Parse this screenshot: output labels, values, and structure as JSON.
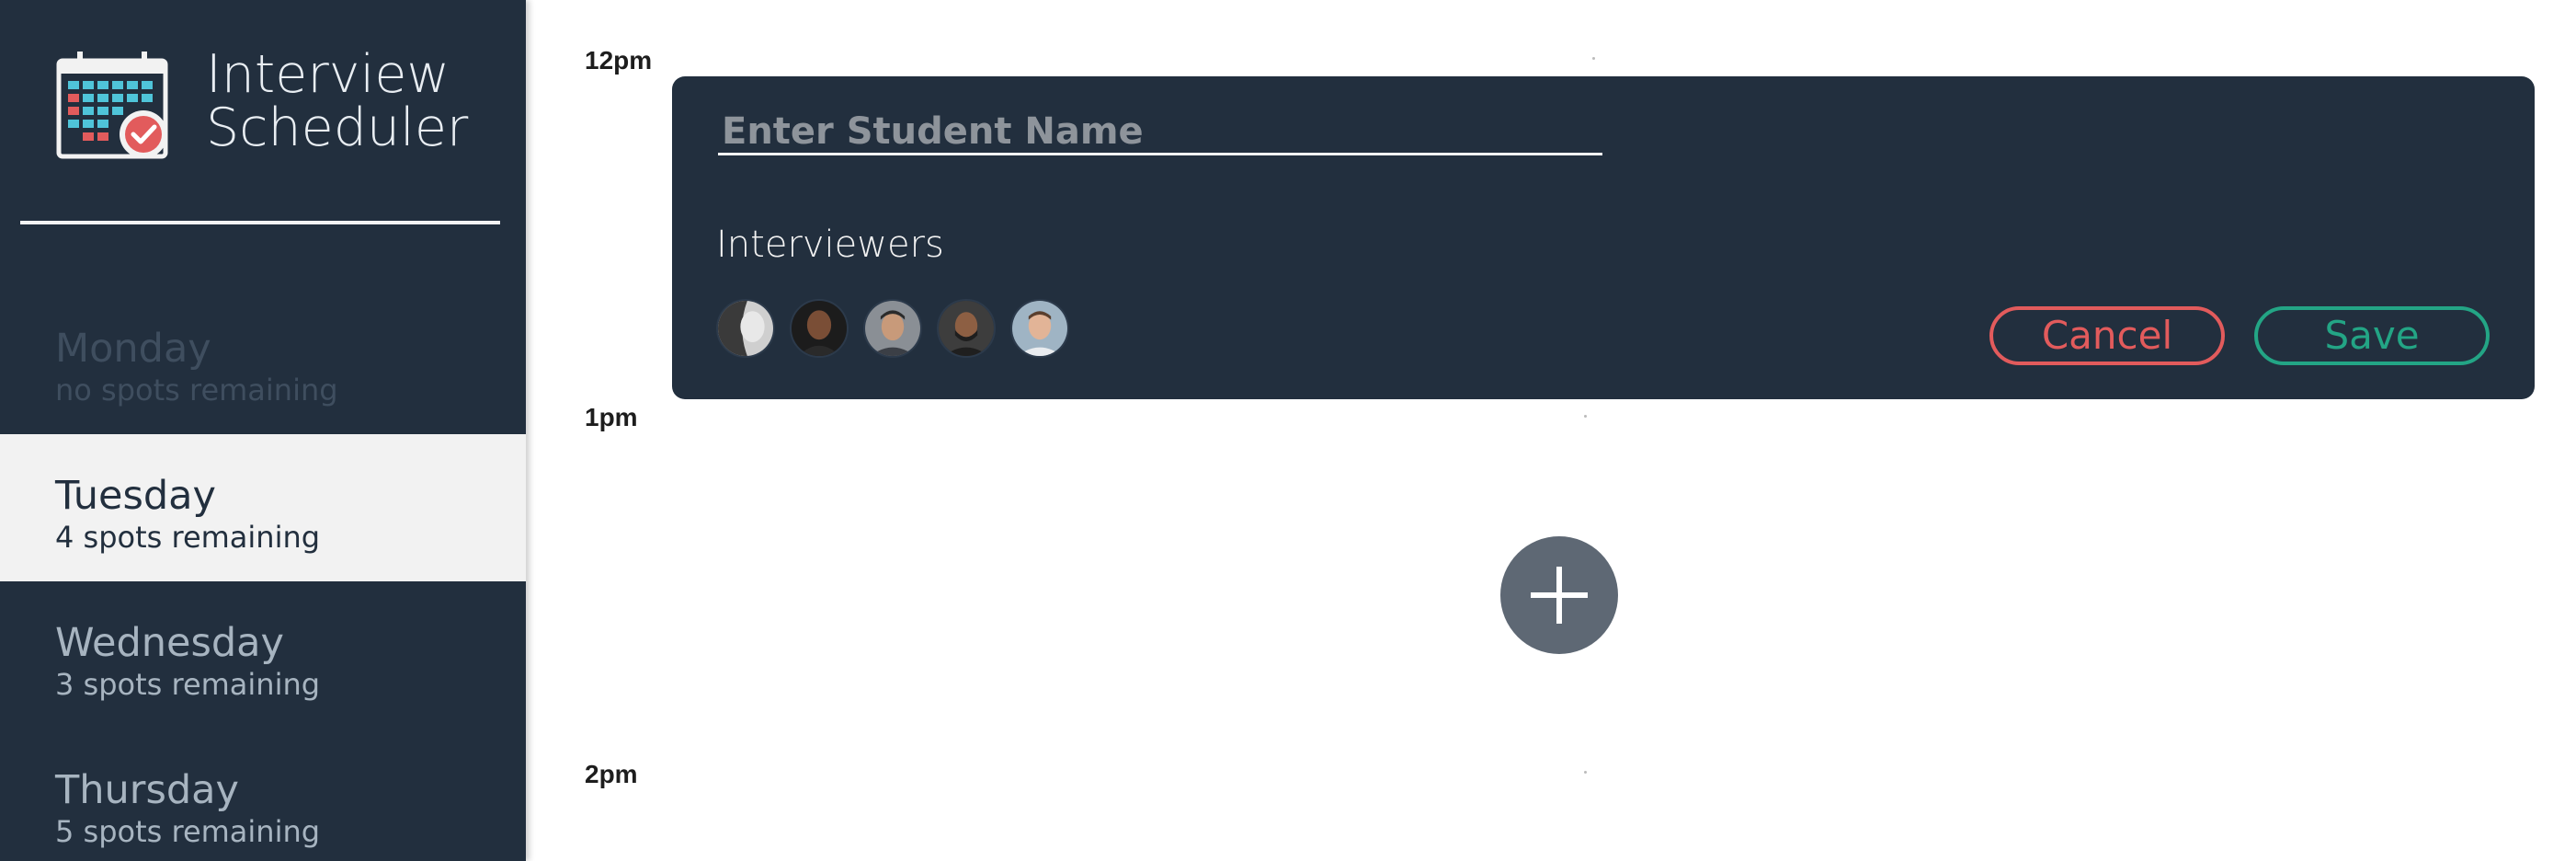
{
  "app": {
    "title_line1": "Interview",
    "title_line2": "Scheduler",
    "logo_icon": "calendar-check-icon"
  },
  "days": [
    {
      "name": "Monday",
      "spots": "no spots remaining",
      "state": "full"
    },
    {
      "name": "Tuesday",
      "spots": "4 spots remaining",
      "state": "selected"
    },
    {
      "name": "Wednesday",
      "spots": "3 spots remaining",
      "state": "default"
    },
    {
      "name": "Thursday",
      "spots": "5 spots remaining",
      "state": "default"
    }
  ],
  "schedule": {
    "times": [
      "12pm",
      "1pm",
      "2pm"
    ]
  },
  "form": {
    "student_placeholder": "Enter Student Name",
    "student_value": "",
    "interviewers_label": "Interviewers",
    "interviewers": [
      {
        "icon": "interviewer-avatar-1"
      },
      {
        "icon": "interviewer-avatar-2"
      },
      {
        "icon": "interviewer-avatar-3"
      },
      {
        "icon": "interviewer-avatar-4"
      },
      {
        "icon": "interviewer-avatar-5"
      }
    ],
    "cancel_label": "Cancel",
    "save_label": "Save"
  },
  "add_button": {
    "icon": "plus-icon"
  },
  "colors": {
    "sidebar": "#222f3e",
    "card": "#222f3e",
    "cancel": "#e25b5c",
    "save": "#23a585",
    "add_button": "#5e6874"
  }
}
